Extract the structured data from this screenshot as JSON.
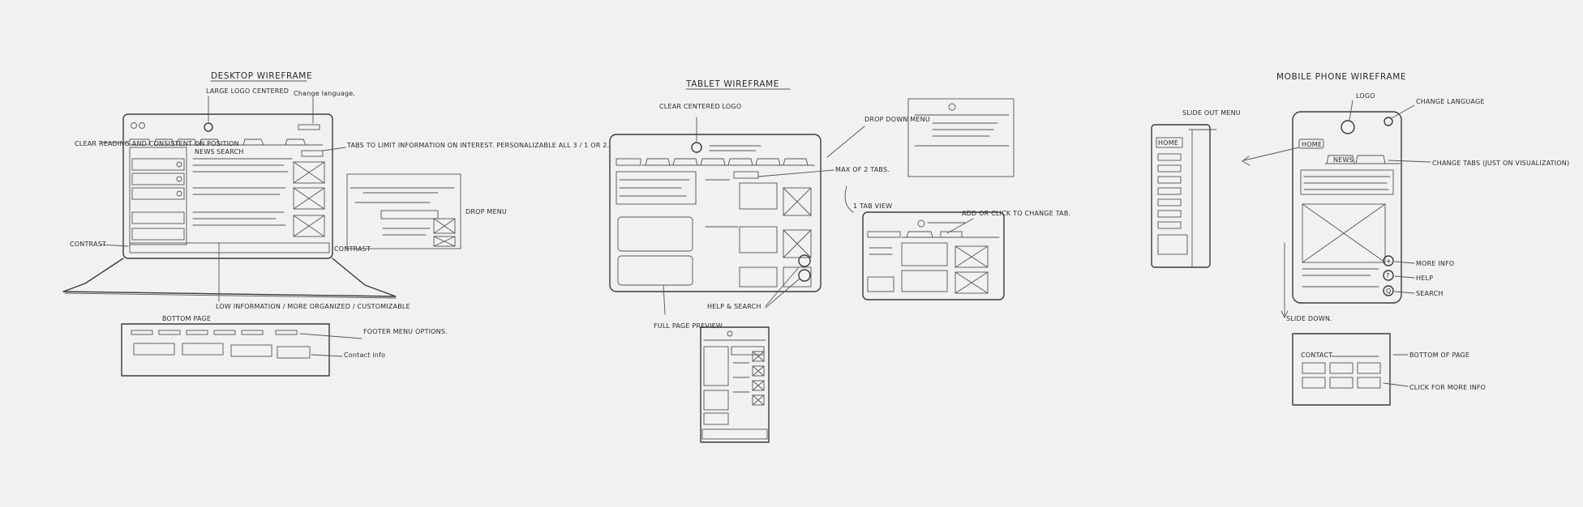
{
  "desktop": {
    "title": "DESKTOP WIREFRAME",
    "labels": {
      "logo": "LARGE LOGO CENTERED",
      "language": "Change language.",
      "menu": "CLEAR READING AND CONSISTENT ON POSITION",
      "tabs": "TABS TO LIMIT INFORMATION ON INTEREST. PERSONALIZABLE ALL 3 / 1 OR 2.",
      "drop_menu": "DROP MENU",
      "contrast": "CONTRAST",
      "bottom_contrast": "CONTRAST",
      "info": "LOW INFORMATION / MORE ORGANIZED / CUSTOMIZABLE",
      "bottom_page": "BOTTOM PAGE",
      "footer_menu": "FOOTER MENU OPTIONS.",
      "contact": "Contact info",
      "tab_news": "NEWS",
      "tab_search": "SEARCH"
    }
  },
  "tablet": {
    "title": "TABLET WIREFRAME",
    "labels": {
      "logo": "CLEAR CENTERED LOGO",
      "drop_menu": "DROP DOWN MENU",
      "max_tabs": "MAX OF 2 TABS.",
      "tab_view": "1 TAB VIEW",
      "add_click": "ADD OR CLICK TO CHANGE TAB.",
      "help_search": "HELP & SEARCH",
      "full_page": "FULL PAGE PREVIEW"
    }
  },
  "mobile": {
    "title": "MOBILE PHONE WIREFRAME",
    "labels": {
      "slide_menu": "SLIDE OUT MENU",
      "logo": "LOGO",
      "language": "CHANGE LANGUAGE",
      "change_tabs": "CHANGE TABS (JUST ON VISUALIZATION)",
      "more_info": "MORE INFO",
      "help": "HELP",
      "search": "SEARCH",
      "slide_down": "SLIDE DOWN.",
      "bottom": "BOTTOM OF PAGE",
      "click_more": "CLICK FOR MORE INFO",
      "home": "HOME",
      "news": "NEWS",
      "contact": "CONTACT",
      "help_icon": "?",
      "more_icon": "+",
      "search_icon": "Q"
    }
  }
}
